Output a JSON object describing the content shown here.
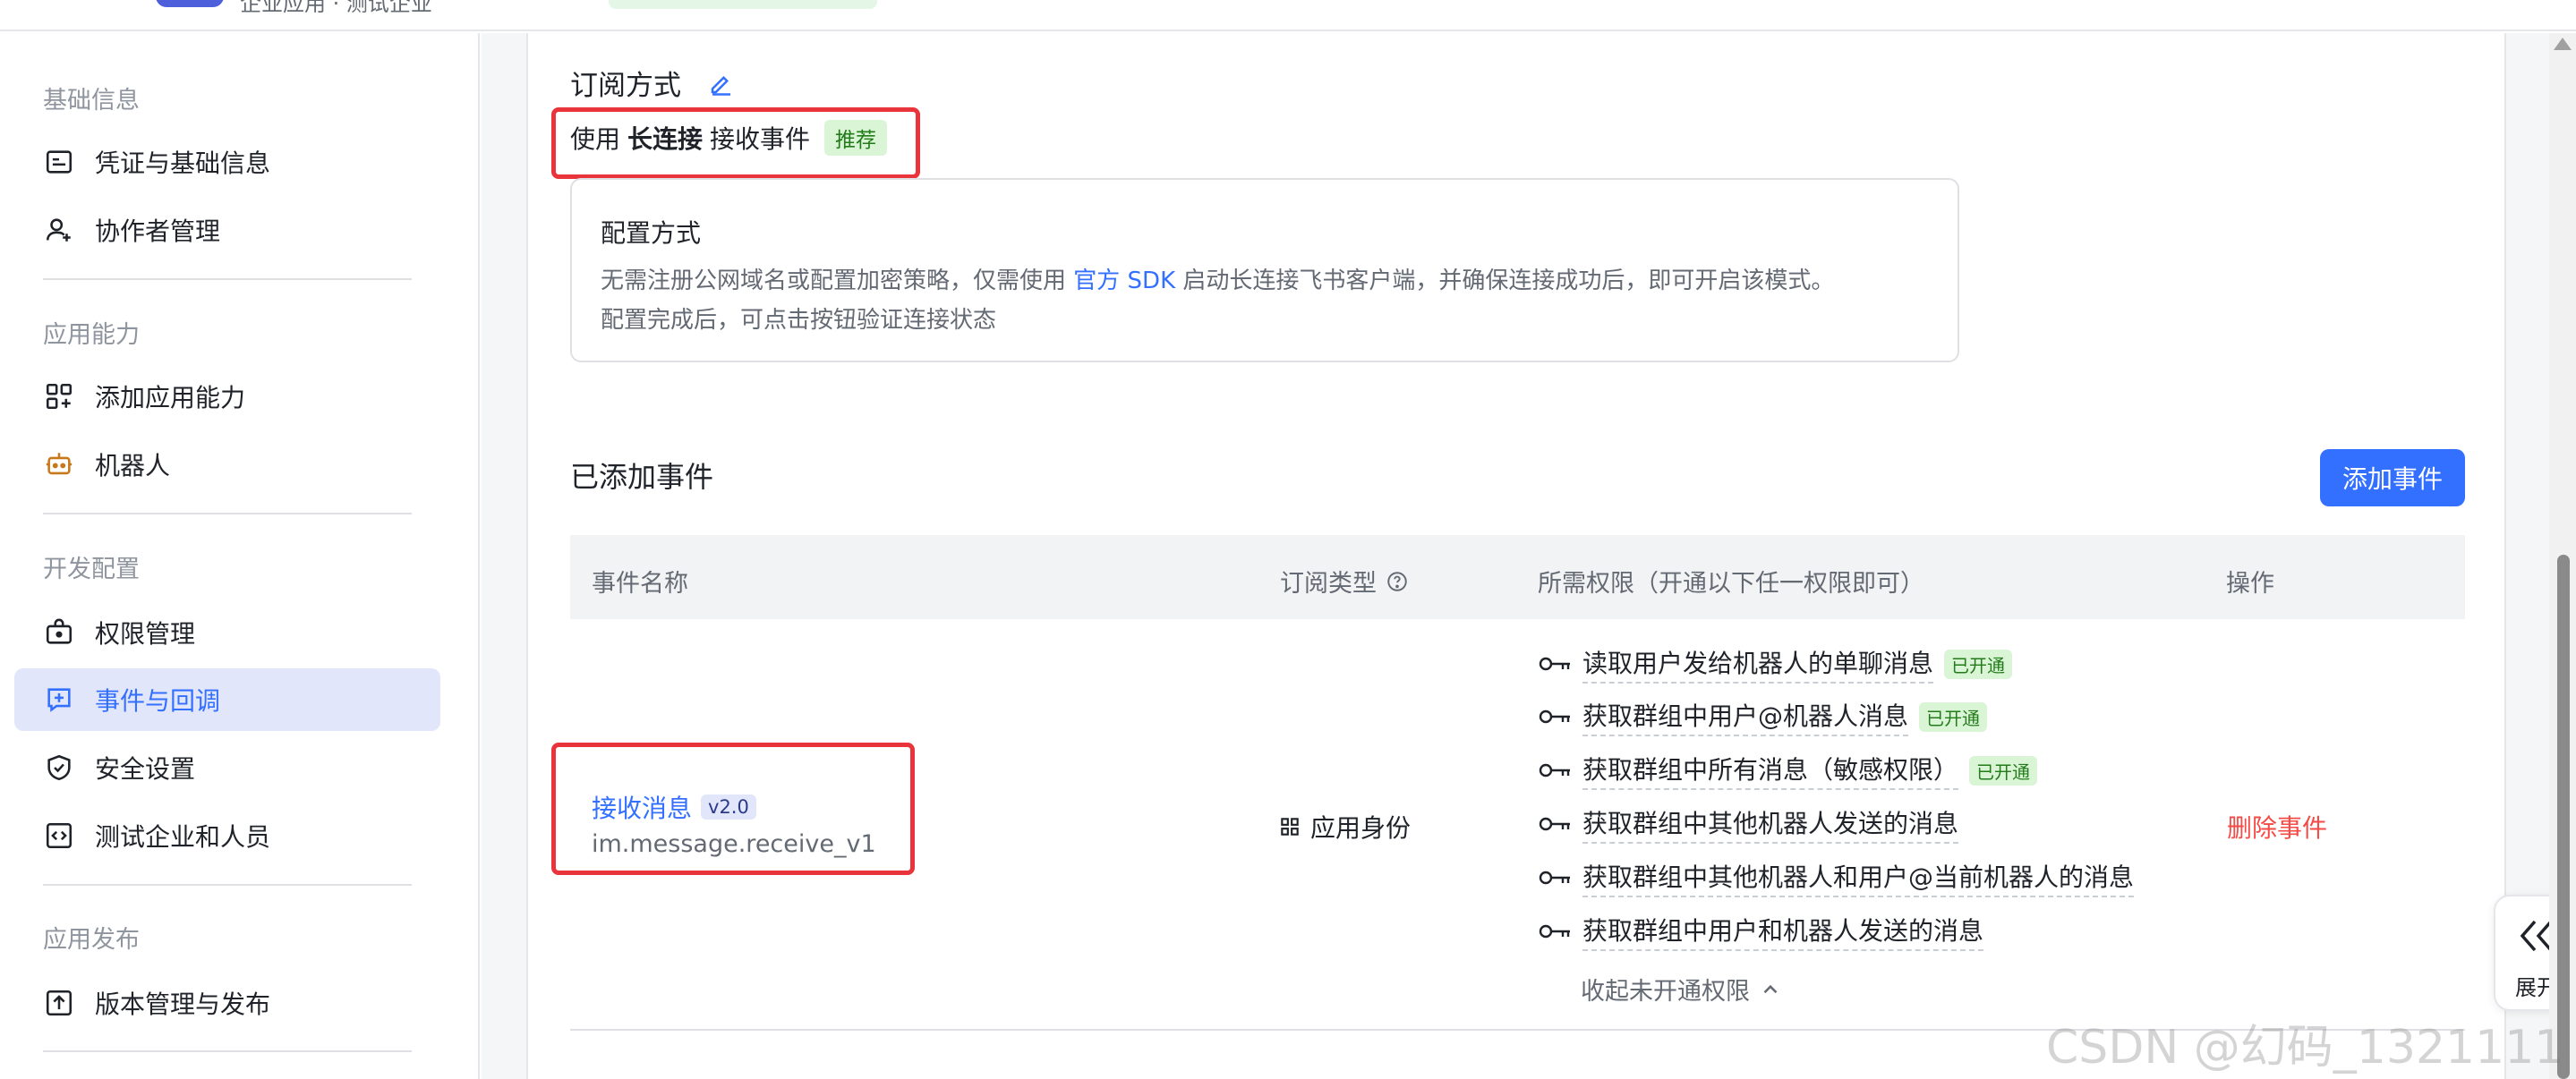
{
  "topbar": {
    "app_subtitle": "企业应用 · 测试企业"
  },
  "sidebar": {
    "groups": [
      {
        "title": "基础信息",
        "items": [
          {
            "label": "凭证与基础信息",
            "icon": "credential-icon"
          },
          {
            "label": "协作者管理",
            "icon": "user-add-icon"
          }
        ]
      },
      {
        "title": "应用能力",
        "items": [
          {
            "label": "添加应用能力",
            "icon": "apps-add-icon"
          },
          {
            "label": "机器人",
            "icon": "robot-icon"
          }
        ]
      },
      {
        "title": "开发配置",
        "items": [
          {
            "label": "权限管理",
            "icon": "permission-icon"
          },
          {
            "label": "事件与回调",
            "icon": "event-icon",
            "active": true
          },
          {
            "label": "安全设置",
            "icon": "shield-icon"
          },
          {
            "label": "测试企业和人员",
            "icon": "code-icon"
          }
        ]
      },
      {
        "title": "应用发布",
        "items": [
          {
            "label": "版本管理与发布",
            "icon": "upload-icon"
          }
        ]
      }
    ]
  },
  "subscription": {
    "title": "订阅方式",
    "mode_prefix": "使用",
    "mode_bold": "长连接",
    "mode_suffix": "接收事件",
    "badge": "推荐",
    "config": {
      "title": "配置方式",
      "line1_before": "无需注册公网域名或配置加密策略，仅需使用",
      "line1_link": "官方 SDK",
      "line1_after": "启动长连接飞书客户端，并确保连接成功后，即可开启该模式。",
      "line2": "配置完成后，可点击按钮验证连接状态"
    }
  },
  "events": {
    "title": "已添加事件",
    "add_button": "添加事件",
    "columns": [
      "事件名称",
      "订阅类型",
      "所需权限（开通以下任一权限即可）",
      "操作"
    ],
    "rows": [
      {
        "name": "接收消息",
        "version": "v2.0",
        "key": "im.message.receive_v1",
        "type": "应用身份",
        "permissions": [
          {
            "text": "读取用户发给机器人的单聊消息",
            "badge": "已开通"
          },
          {
            "text": "获取群组中用户@机器人消息",
            "badge": "已开通"
          },
          {
            "text": "获取群组中所有消息（敏感权限）",
            "badge": "已开通"
          },
          {
            "text": "获取群组中其他机器人发送的消息",
            "badge": ""
          },
          {
            "text": "获取群组中其他机器人和用户@当前机器人的消息",
            "badge": ""
          },
          {
            "text": "获取群组中用户和机器人发送的消息",
            "badge": ""
          }
        ],
        "collapse_label": "收起未开通权限",
        "action": "删除事件"
      }
    ]
  },
  "float": {
    "expand_label": "展开"
  },
  "watermark": "CSDN @幻码_1321111",
  "colors": {
    "accent": "#3370ff",
    "danger": "#f54a45",
    "success_bg": "#d9f5d6",
    "highlight": "#e8343a"
  }
}
